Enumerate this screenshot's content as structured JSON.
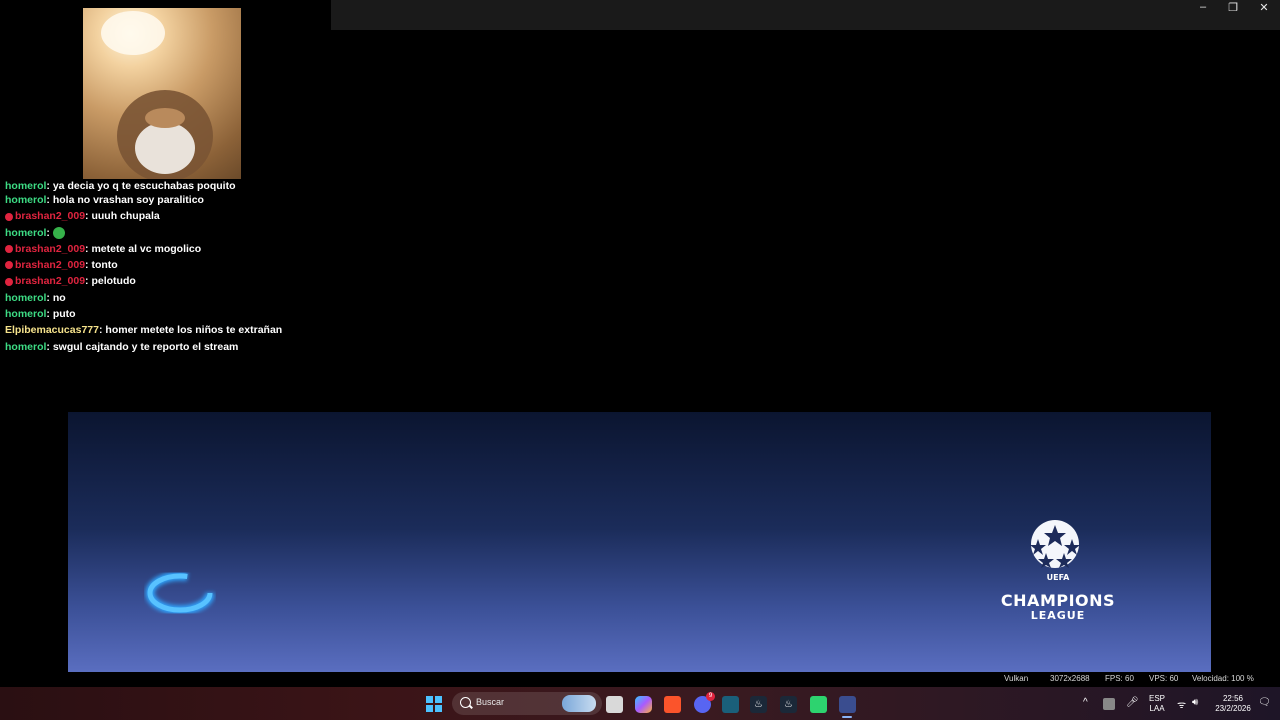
{
  "window": {
    "minimize_glyph": "–",
    "maximize_glyph": "❐",
    "close_glyph": "✕"
  },
  "chat": [
    {
      "user": "homerol",
      "sep": ": ",
      "message": "ya decia yo q te escuchabas poquito",
      "color": "#3ddc84",
      "badge": false
    },
    {
      "user": "homerol",
      "sep": ": ",
      "message": "hola no vrashan soy paralitico",
      "color": "#3ddc84",
      "badge": false
    },
    {
      "user": "brashan2_009",
      "sep": ": ",
      "message": "uuuh chupala",
      "color": "#e0243f",
      "badge": true
    },
    {
      "user": "homerol",
      "sep": ": ",
      "message": "",
      "color": "#3ddc84",
      "badge": false,
      "emote": "green-emote"
    },
    {
      "user": "brashan2_009",
      "sep": ": ",
      "message": "metete al vc mogolico",
      "color": "#e0243f",
      "badge": true
    },
    {
      "user": "brashan2_009",
      "sep": ": ",
      "message": "tonto",
      "color": "#e0243f",
      "badge": true
    },
    {
      "user": "brashan2_009",
      "sep": ": ",
      "message": "pelotudo",
      "color": "#e0243f",
      "badge": true
    },
    {
      "user": "homerol",
      "sep": ": ",
      "message": "no",
      "color": "#3ddc84",
      "badge": false
    },
    {
      "user": "homerol",
      "sep": ": ",
      "message": "puto",
      "color": "#3ddc84",
      "badge": false
    },
    {
      "user": "Elpibemacucas777",
      "sep": ": ",
      "message": "homer metete los niños te extrañan",
      "color": "#f6e38c",
      "badge": false
    },
    {
      "user": "homerol",
      "sep": ": ",
      "message": "swgul cajtando y te reporto el stream",
      "color": "#3ddc84",
      "badge": false
    }
  ],
  "game": {
    "logo_line1": "CHAMPIONS",
    "logo_line2": "LEAGUE",
    "logo_small": "UEFA",
    "logo_icon": "starball-icon",
    "spinner_icon": "loading-spinner-icon"
  },
  "status": {
    "renderer": "Vulkan",
    "resolution": "3072x2688",
    "fps": "FPS: 60",
    "vps": "VPS: 60",
    "speed": "Velocidad: 100 %"
  },
  "taskbar": {
    "search_placeholder": "Buscar",
    "apps": [
      "windows-start-icon",
      "task-view-icon",
      "copilot-icon",
      "brave-icon",
      "discord-icon",
      "photos-icon",
      "steam-icon",
      "steam-icon",
      "app-icon",
      "emulator-icon"
    ],
    "discord_badge": "9",
    "language_line1": "ESP",
    "language_line2": "LAA",
    "time": "22:56",
    "date": "23/2/2026"
  }
}
